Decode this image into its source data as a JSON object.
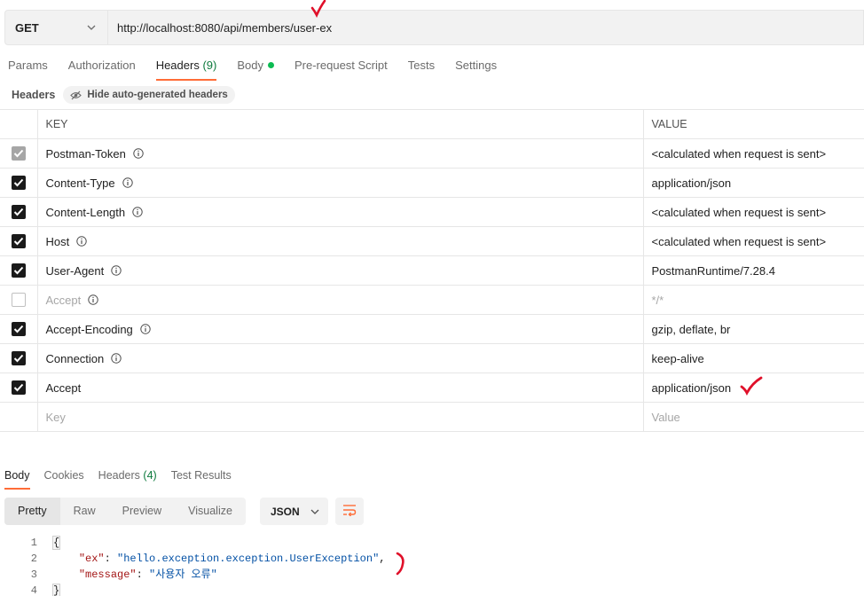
{
  "request": {
    "method": "GET",
    "url": "http://localhost:8080/api/members/user-ex"
  },
  "request_tabs": [
    {
      "label": "Params"
    },
    {
      "label": "Authorization"
    },
    {
      "label": "Headers",
      "count": "(9)"
    },
    {
      "label": "Body"
    },
    {
      "label": "Pre-request Script"
    },
    {
      "label": "Tests"
    },
    {
      "label": "Settings"
    }
  ],
  "headers_section": {
    "title": "Headers",
    "hide_button": "Hide auto-generated headers",
    "col_key": "KEY",
    "col_value": "VALUE",
    "rows": [
      {
        "key": "Postman-Token",
        "value": "<calculated when request is sent>"
      },
      {
        "key": "Content-Type",
        "value": "application/json"
      },
      {
        "key": "Content-Length",
        "value": "<calculated when request is sent>"
      },
      {
        "key": "Host",
        "value": "<calculated when request is sent>"
      },
      {
        "key": "User-Agent",
        "value": "PostmanRuntime/7.28.4"
      },
      {
        "key": "Accept",
        "value": "*/*"
      },
      {
        "key": "Accept-Encoding",
        "value": "gzip, deflate, br"
      },
      {
        "key": "Connection",
        "value": "keep-alive"
      },
      {
        "key": "Accept",
        "value": "application/json"
      }
    ],
    "new_key_placeholder": "Key",
    "new_value_placeholder": "Value"
  },
  "response_tabs": [
    {
      "label": "Body"
    },
    {
      "label": "Cookies"
    },
    {
      "label": "Headers",
      "count": "(4)"
    },
    {
      "label": "Test Results"
    }
  ],
  "format_buttons": [
    "Pretty",
    "Raw",
    "Preview",
    "Visualize"
  ],
  "format_select": "JSON",
  "response_body": {
    "line_numbers": [
      "1",
      "2",
      "3",
      "4"
    ],
    "open_brace": "{",
    "close_brace": "}",
    "key1": "\"ex\"",
    "val1": "\"hello.exception.exception.UserException\"",
    "key2": "\"message\"",
    "val2": "\"사용자 오류\""
  },
  "colors": {
    "accent": "#ff6c37",
    "annotation_red": "#e0102a",
    "status_green": "#0cbb52"
  }
}
